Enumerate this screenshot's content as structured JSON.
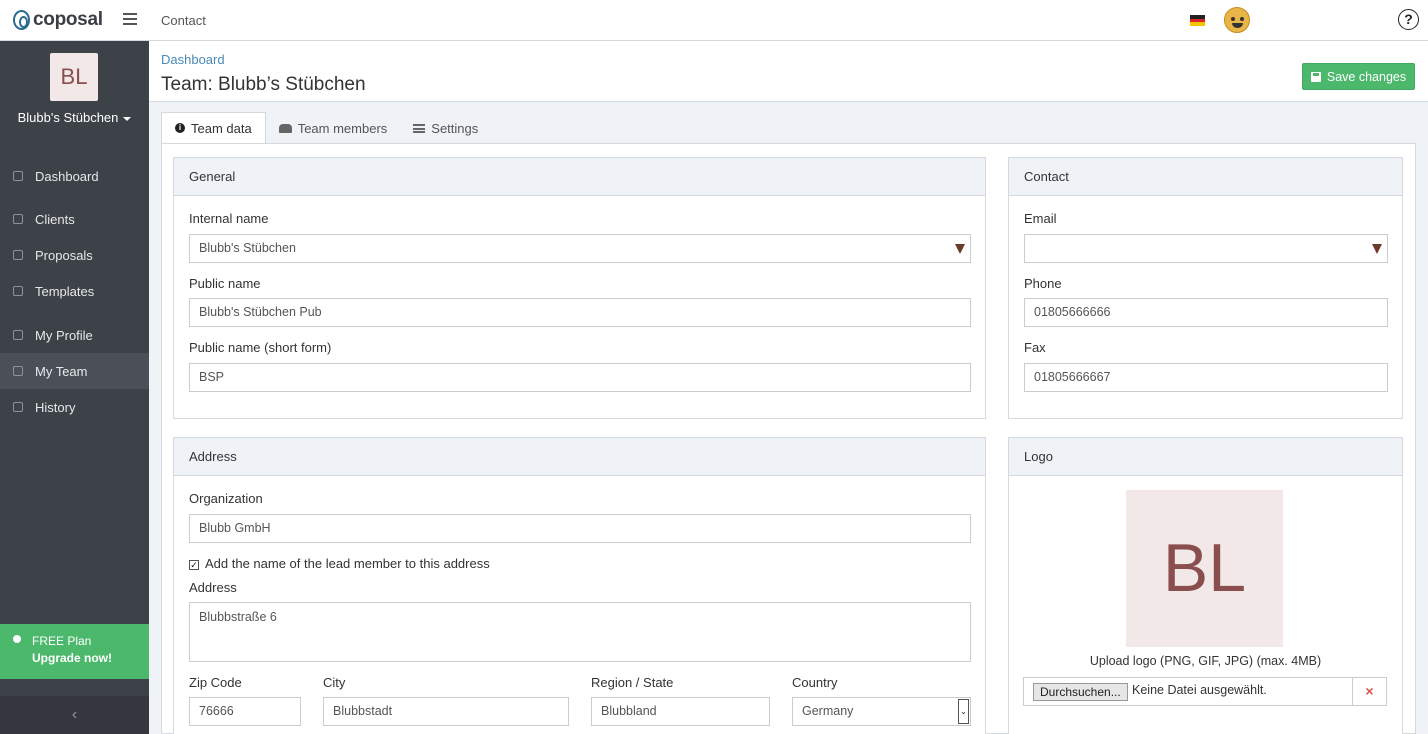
{
  "app": {
    "brand": "coposal",
    "top_link": "Contact",
    "help": "?"
  },
  "colors": {
    "accent": "#4cb86c",
    "sidebar": "#3d4148",
    "link": "#4a8ab8",
    "avatar_bg": "#f2e8e8",
    "avatar_text": "#8a4e4e"
  },
  "sidebar": {
    "team_initials": "BL",
    "team_name": "Blubb's Stübchen",
    "items": [
      {
        "label": "Dashboard",
        "icon": "home-icon"
      },
      {
        "label": "Clients",
        "icon": "user-icon"
      },
      {
        "label": "Proposals",
        "icon": "edit-icon"
      },
      {
        "label": "Templates",
        "icon": "layers-icon"
      },
      {
        "label": "My Profile",
        "icon": "gear-icon"
      },
      {
        "label": "My Team",
        "icon": "team-icon",
        "active": true
      },
      {
        "label": "History",
        "icon": "calendar-icon"
      }
    ],
    "plan_label": "FREE Plan",
    "upgrade_label": "Upgrade now!",
    "collapse": "‹"
  },
  "header": {
    "breadcrumb": "Dashboard",
    "title": "Team: Blubb’s Stübchen",
    "save_label": "Save changes"
  },
  "tabs": [
    {
      "label": "Team data",
      "active": true
    },
    {
      "label": "Team members"
    },
    {
      "label": "Settings"
    }
  ],
  "general": {
    "title": "General",
    "internal_name_label": "Internal name",
    "internal_name_value": "Blubb's Stübchen",
    "public_name_label": "Public name",
    "public_name_value": "Blubb's Stübchen Pub",
    "short_name_label": "Public name (short form)",
    "short_name_value": "BSP"
  },
  "contact": {
    "title": "Contact",
    "email_label": "Email",
    "email_value": "",
    "phone_label": "Phone",
    "phone_value": "01805666666",
    "fax_label": "Fax",
    "fax_value": "01805666667"
  },
  "address": {
    "title": "Address",
    "organization_label": "Organization",
    "organization_value": "Blubb GmbH",
    "add_lead_label": "Add the name of the lead member to this address",
    "add_lead_checked": true,
    "address_label": "Address",
    "address_value": "Blubbstraße 6",
    "zip_label": "Zip Code",
    "zip_value": "76666",
    "city_label": "City",
    "city_value": "Blubbstadt",
    "region_label": "Region / State",
    "region_value": "Blubbland",
    "country_label": "Country",
    "country_value": "Germany"
  },
  "logo": {
    "title": "Logo",
    "initials": "BL",
    "upload_label": "Upload logo (PNG, GIF, JPG) (max. 4MB)",
    "browse_label": "Durchsuchen...",
    "no_file_label": "Keine Datei ausgewählt.",
    "clear": "×"
  }
}
